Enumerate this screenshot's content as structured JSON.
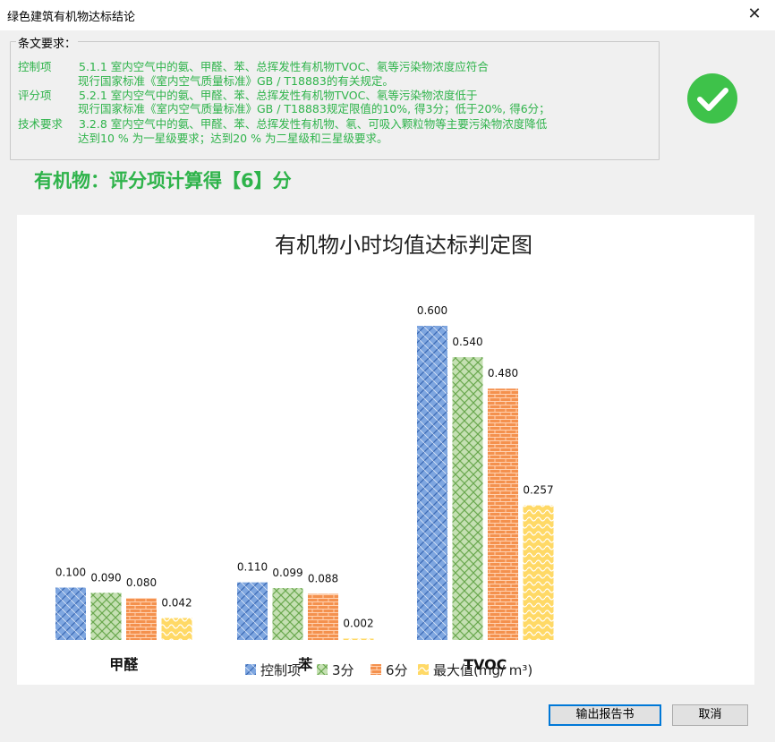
{
  "window": {
    "title": "绿色建筑有机物达标结论"
  },
  "requirements": {
    "label": "条文要求：",
    "items": [
      {
        "tag": "控制项",
        "lines": [
          "5.1.1 室内空气中的氨、甲醛、苯、总挥发性有机物TVOC、氡等污染物浓度应符合",
          "现行国家标准《室内空气质量标准》GB / T18883的有关规定。"
        ]
      },
      {
        "tag": "评分项",
        "lines": [
          "5.2.1 室内空气中的氨、甲醛、苯、总挥发性有机物TVOC、氡等污染物浓度低于",
          "现行国家标准《室内空气质量标准》GB / T18883规定限值的10%, 得3分；低于20%, 得6分；"
        ]
      },
      {
        "tag": "技术要求",
        "lines": [
          "3.2.8 室内空气中的氨、甲醛、苯、总挥发性有机物、氡、可吸入颗粒物等主要污染物浓度降低",
          "达到10 % 为一星级要求；达到20 % 为二星级和三星级要求。"
        ]
      }
    ]
  },
  "score_text": "有机物：评分项计算得【6】分",
  "status_icon": "check-circle-icon",
  "colors": {
    "accent_green": "#2eb34a",
    "check_green": "#3ec24a"
  },
  "chart_data": {
    "type": "bar",
    "title": "有机物小时均值达标判定图",
    "categories": [
      "甲醛",
      "苯",
      "TVOC"
    ],
    "series": [
      {
        "name": "控制项",
        "values": [
          0.1,
          0.11,
          0.6
        ],
        "labels": [
          "0.100",
          "0.110",
          "0.600"
        ],
        "color": "#7ea6e0",
        "pattern": "hatch-blue"
      },
      {
        "name": "3分",
        "values": [
          0.09,
          0.099,
          0.54
        ],
        "labels": [
          "0.090",
          "0.099",
          "0.540"
        ],
        "color": "#a9d18e",
        "pattern": "hatch-green"
      },
      {
        "name": "6分",
        "values": [
          0.08,
          0.088,
          0.48
        ],
        "labels": [
          "0.080",
          "0.088",
          "0.480"
        ],
        "color": "#f4914e",
        "pattern": "brick-orange"
      },
      {
        "name": "最大值(mg/ m³)",
        "values": [
          0.042,
          0.002,
          0.257
        ],
        "labels": [
          "0.042",
          "0.002",
          "0.257"
        ],
        "color": "#ffd966",
        "pattern": "wave-yellow"
      }
    ],
    "ylim": [
      0,
      0.6
    ],
    "grid": false,
    "legend": "bottom"
  },
  "buttons": {
    "export": "输出报告书",
    "cancel": "取消"
  }
}
